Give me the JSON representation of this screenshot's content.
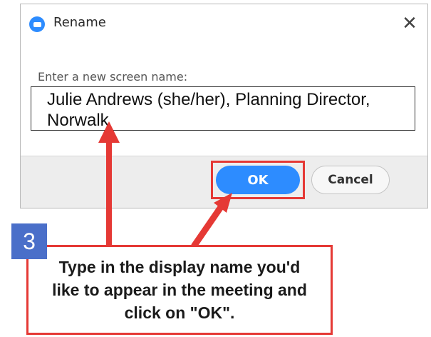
{
  "dialog": {
    "title": "Rename",
    "close_glyph": "✕",
    "prompt_label": "Enter a new screen name:",
    "name_value": "Julie Andrews (she/her), Planning Director, Norwalk",
    "ok_label": "OK",
    "cancel_label": "Cancel"
  },
  "annotation": {
    "step_number": "3",
    "instruction": "Type in the display name you'd like to appear in the meeting and click on \"OK\".",
    "highlight_color": "#e53935",
    "badge_color": "#4a6fc9"
  },
  "colors": {
    "accent": "#2d8cff",
    "footer_bg": "#ededed"
  },
  "icons": {
    "app": "zoom-app-icon",
    "close": "close-icon"
  }
}
